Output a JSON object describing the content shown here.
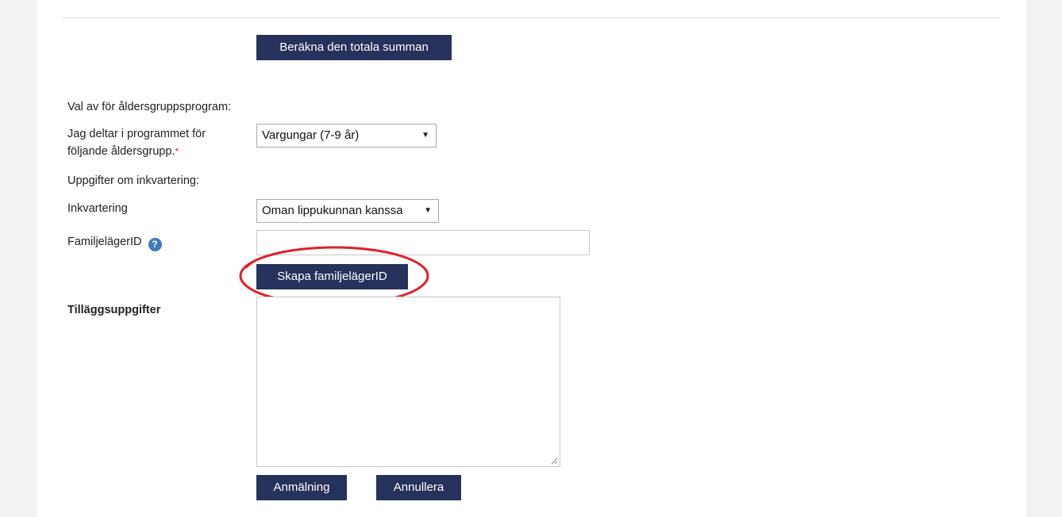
{
  "buttons": {
    "calculate_total": "Beräkna den totala summan",
    "create_family_camp_id": "Skapa familjelägerID",
    "register": "Anmälning",
    "cancel": "Annullera"
  },
  "form": {
    "age_group_section": "Val av för åldersgruppsprogram:",
    "age_group_label_line1": "Jag deltar i programmet för",
    "age_group_label_line2": "följande åldersgrupp.",
    "required_marker": "*",
    "age_group_selected": "Vargungar (7-9 år)",
    "accommodation_section": "Uppgifter om inkvartering:",
    "accommodation_label": "Inkvartering",
    "accommodation_selected": "Oman lippukunnan kanssa",
    "family_camp_id_label": "FamiljelägerID",
    "family_camp_id_value": "",
    "additional_info_label": "Tilläggsuppgifter",
    "additional_info_value": ""
  },
  "icons": {
    "help": "help-icon",
    "dropdown": "chevron-down-icon"
  },
  "colors": {
    "button_bg": "#26325b",
    "highlight": "#e0202a",
    "help_icon": "#3d7ac0"
  }
}
